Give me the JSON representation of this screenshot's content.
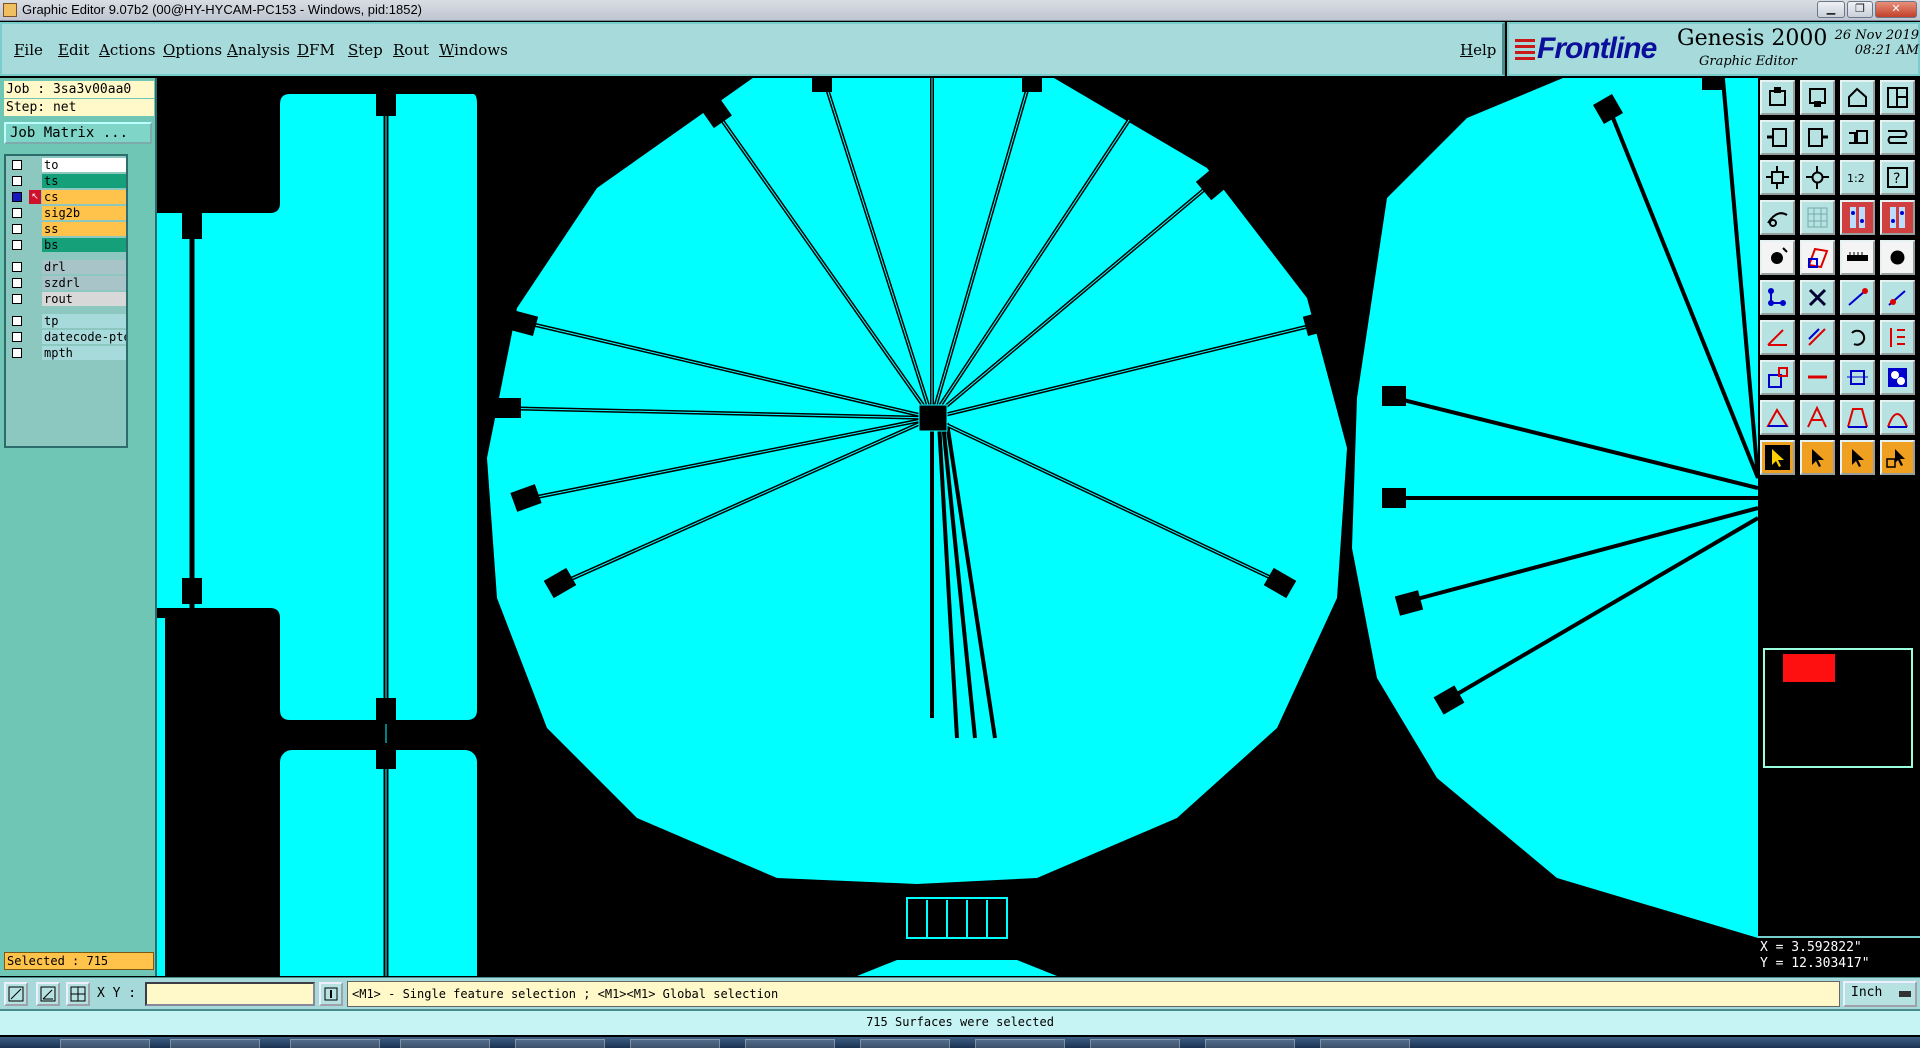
{
  "window": {
    "title": "Graphic Editor 9.07b2 (00@HY-HYCAM-PC153 - Windows, pid:1852)"
  },
  "menu": {
    "items": [
      "File",
      "Edit",
      "Actions",
      "Options",
      "Analysis",
      "DFM",
      "Step",
      "Rout",
      "Windows"
    ],
    "help": "Help"
  },
  "brand": {
    "logo": "Frontline",
    "product": "Genesis 2000",
    "subtitle": "Graphic Editor",
    "date": "26 Nov 2019",
    "time": "08:21 AM"
  },
  "job": {
    "job_line": "Job : 3sa3v00aa0",
    "step_line": "Step: net",
    "matrix_button": "Job Matrix ..."
  },
  "layers": [
    {
      "name": "to",
      "color": "#ffffff",
      "checked": false
    },
    {
      "name": "ts",
      "color": "#16a07a",
      "checked": false
    },
    {
      "name": "cs",
      "color": "#ffc24a",
      "checked": true
    },
    {
      "name": "sig2b",
      "color": "#ffc24a",
      "checked": false
    },
    {
      "name": "ss",
      "color": "#ffc24a",
      "checked": false
    },
    {
      "name": "bs",
      "color": "#16a07a",
      "checked": false
    },
    {
      "name": "drl",
      "color": "#a8c4c8",
      "checked": false
    },
    {
      "name": "szdrl",
      "color": "#a8c4c8",
      "checked": false
    },
    {
      "name": "rout",
      "color": "#d8d8d8",
      "checked": false
    },
    {
      "name": "tp",
      "color": "#a7dada",
      "checked": false
    },
    {
      "name": "datecode-pte",
      "color": "#a7dada",
      "checked": false
    },
    {
      "name": "mpth",
      "color": "#a7dada",
      "checked": false
    }
  ],
  "selection": {
    "label": "Selected : 715"
  },
  "canvas": {
    "copper_color": "#00ffff",
    "background_color": "#000000"
  },
  "coords": {
    "x": "X = 3.592822\"",
    "y": "Y = 12.303417\""
  },
  "command": {
    "xy_label": "X Y :",
    "xy_value": "",
    "message": "<M1> - Single feature selection ; <M1><M1> Global selection",
    "unit": "Inch"
  },
  "status": {
    "message": "715 Surfaces were selected"
  },
  "toolbar_icons": [
    "window-icon",
    "import-icon",
    "home-icon",
    "panel-icon",
    "prev-icon",
    "next-icon",
    "undo-icon",
    "route-icon",
    "zoom-fit-icon",
    "pan-icon",
    "scale-icon",
    "help-icon",
    "measure-icon",
    "grid-icon",
    "layers-icon",
    "split-icon",
    "pad-icon",
    "surface-icon",
    "ruler-icon",
    "dot-icon",
    "connect-icon",
    "cross-icon",
    "line-icon",
    "arc-icon",
    "angle-icon",
    "diag-icon",
    "rotate-icon",
    "mirror-icon",
    "snap-icon",
    "minus-icon",
    "fit-icon",
    "copy-icon",
    "triangle-icon",
    "a-icon",
    "arch-icon",
    "arch2-icon",
    "select-icon",
    "select-yellow-icon",
    "select-orange-icon",
    "select-multi-icon"
  ]
}
